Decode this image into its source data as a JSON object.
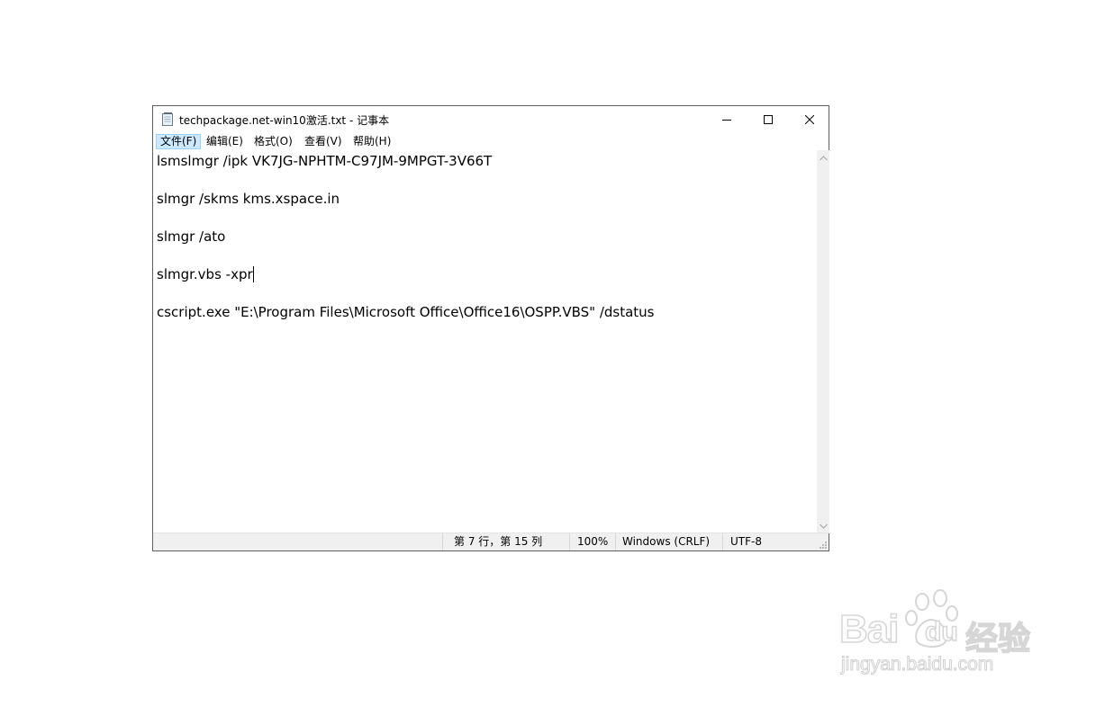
{
  "window": {
    "title": "techpackage.net-win10激活.txt - 记事本",
    "controls": {
      "minimize_icon": "minimize-icon",
      "maximize_icon": "maximize-icon",
      "close_icon": "close-icon"
    }
  },
  "menu": [
    {
      "label": "文件(F)"
    },
    {
      "label": "编辑(E)"
    },
    {
      "label": "格式(O)"
    },
    {
      "label": "查看(V)"
    },
    {
      "label": "帮助(H)"
    }
  ],
  "editor": {
    "lines": [
      "lsmslmgr /ipk VK7JG-NPHTM-C97JM-9MPGT-3V66T",
      "",
      "slmgr /skms kms.xspace.in",
      "",
      "slmgr /ato",
      "",
      "slmgr.vbs -xpr",
      "",
      "cscript.exe \"E:\\Program Files\\Microsoft Office\\Office16\\OSPP.VBS\" /dstatus"
    ]
  },
  "statusbar": {
    "position": "第 7 行，第 15 列",
    "zoom": "100%",
    "line_ending": "Windows (CRLF)",
    "encoding": "UTF-8"
  },
  "watermark": {
    "brand_latin": "Bai",
    "brand_du": "du",
    "brand_cn": "经验",
    "url": "jingyan.baidu.com"
  }
}
